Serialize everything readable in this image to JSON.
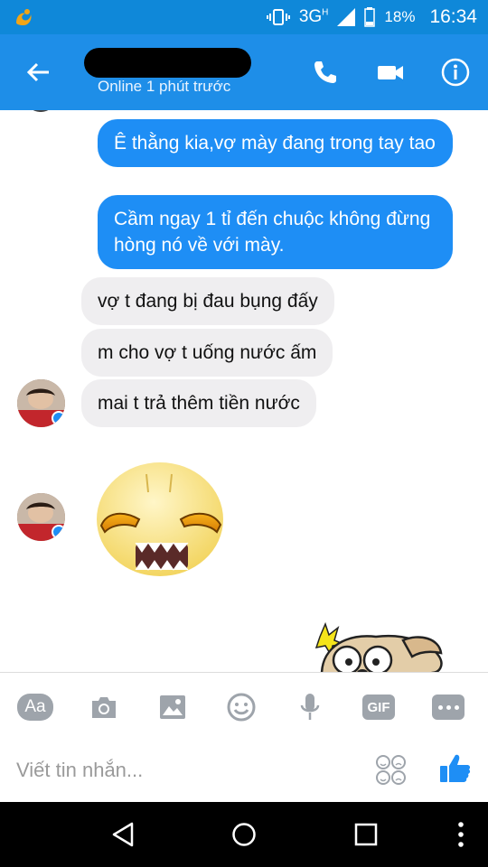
{
  "status_bar": {
    "network": "3G",
    "network_sup": "H",
    "battery": "18%",
    "time": "16:34"
  },
  "header": {
    "status": "Online 1 phút trước"
  },
  "messages": [
    {
      "dir": "out",
      "text": "Ê thằng kia,vợ mày đang trong tay tao"
    },
    {
      "dir": "out",
      "text": "Cầm ngay 1 tỉ đến chuộc không đừng hòng nó về với mày."
    },
    {
      "dir": "in",
      "text": "vợ t đang bị  đau bụng đấy"
    },
    {
      "dir": "in",
      "text": "m cho vợ t uống nước ấm"
    },
    {
      "dir": "in",
      "text": "mai t trả thêm tiền nước"
    }
  ],
  "composer": {
    "aa_label": "Aa",
    "gif_label": "GIF",
    "placeholder": "Viết tin nhắn..."
  },
  "colors": {
    "header": "#1e8ee8",
    "status_bar": "#0f88d9",
    "outgoing_bubble": "#1e8ef5",
    "incoming_bubble": "#efeef0",
    "icon_gray": "#9ea4ab",
    "like_blue": "#1e8ef5"
  }
}
